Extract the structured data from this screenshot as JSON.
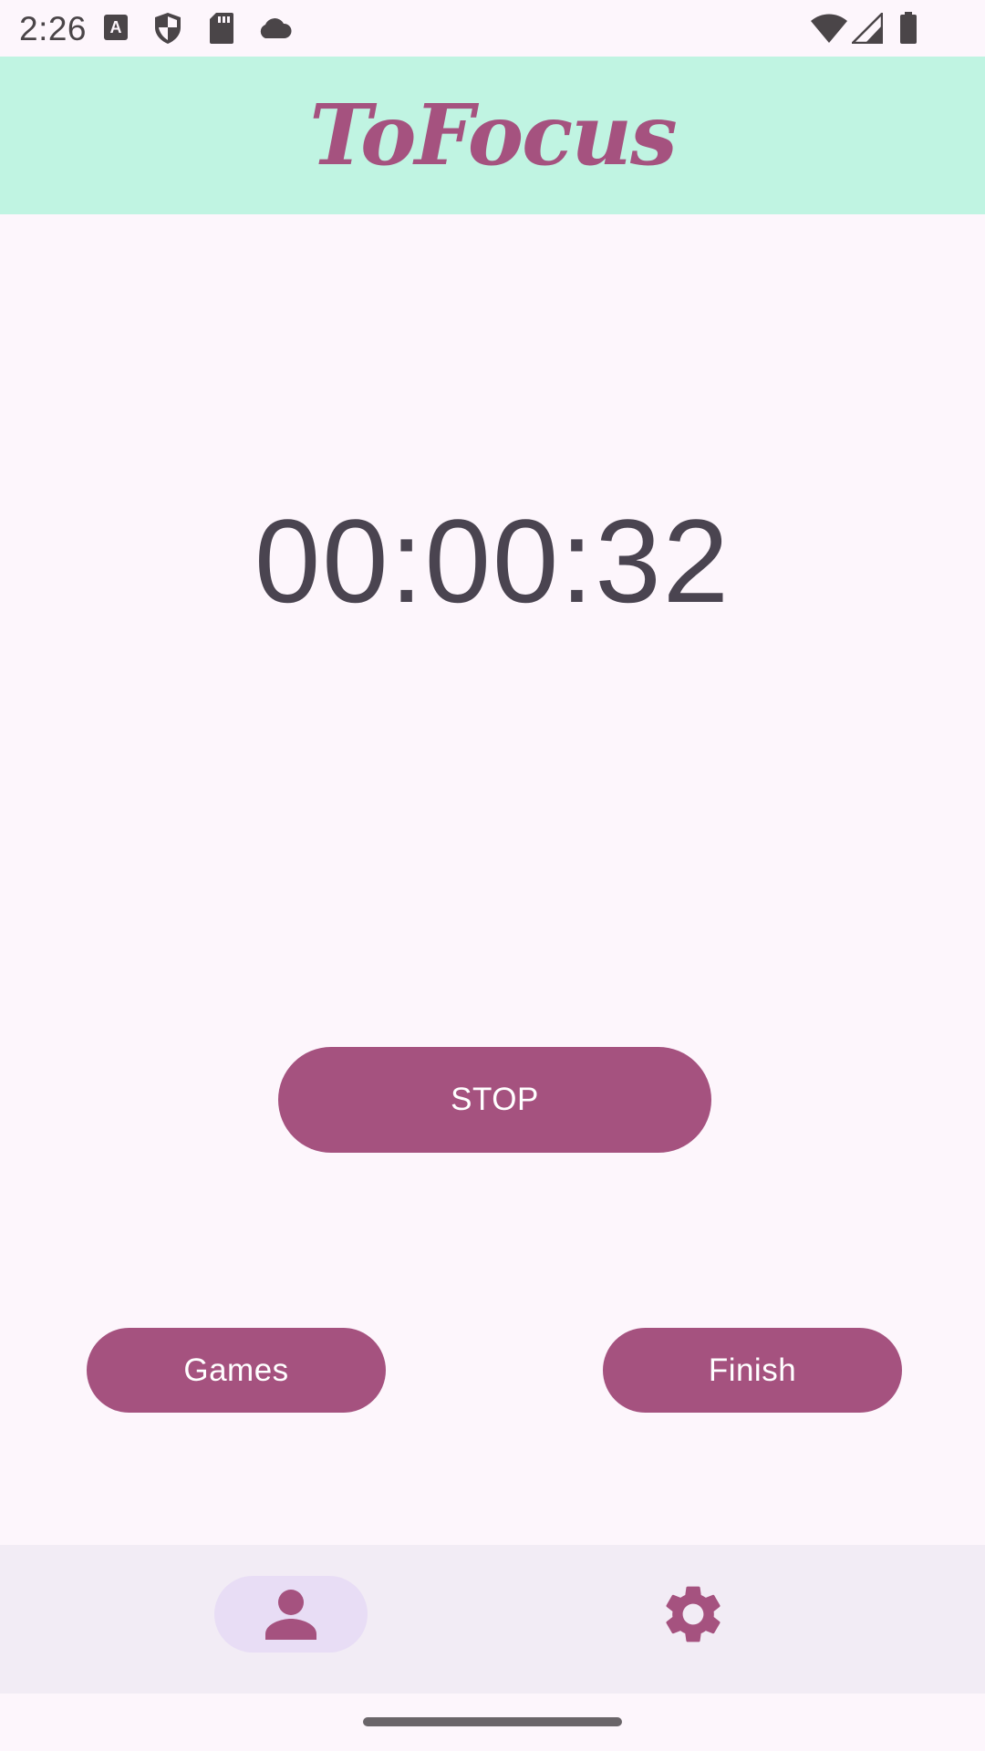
{
  "status_bar": {
    "time": "2:26",
    "icons": [
      "text-notification-icon",
      "shield-icon",
      "sd-card-icon",
      "cloud-icon",
      "wifi-icon",
      "cell-signal-icon",
      "battery-icon"
    ]
  },
  "app_bar": {
    "title": "ToFocus"
  },
  "timer": {
    "value": "00:00:32"
  },
  "controls": {
    "stop_label": "STOP",
    "games_label": "Games",
    "finish_label": "Finish"
  },
  "bottom_nav": {
    "items": [
      {
        "icon": "person-icon",
        "selected": true
      },
      {
        "icon": "gear-icon",
        "selected": false
      }
    ]
  },
  "colors": {
    "accent": "#a5527f",
    "app_bar_bg": "#c0f4e2",
    "page_bg": "#fdf6fc",
    "nav_bg": "#f2ecf5",
    "nav_selected_bg": "#e8ddf5",
    "timer_text": "#4a4450"
  }
}
